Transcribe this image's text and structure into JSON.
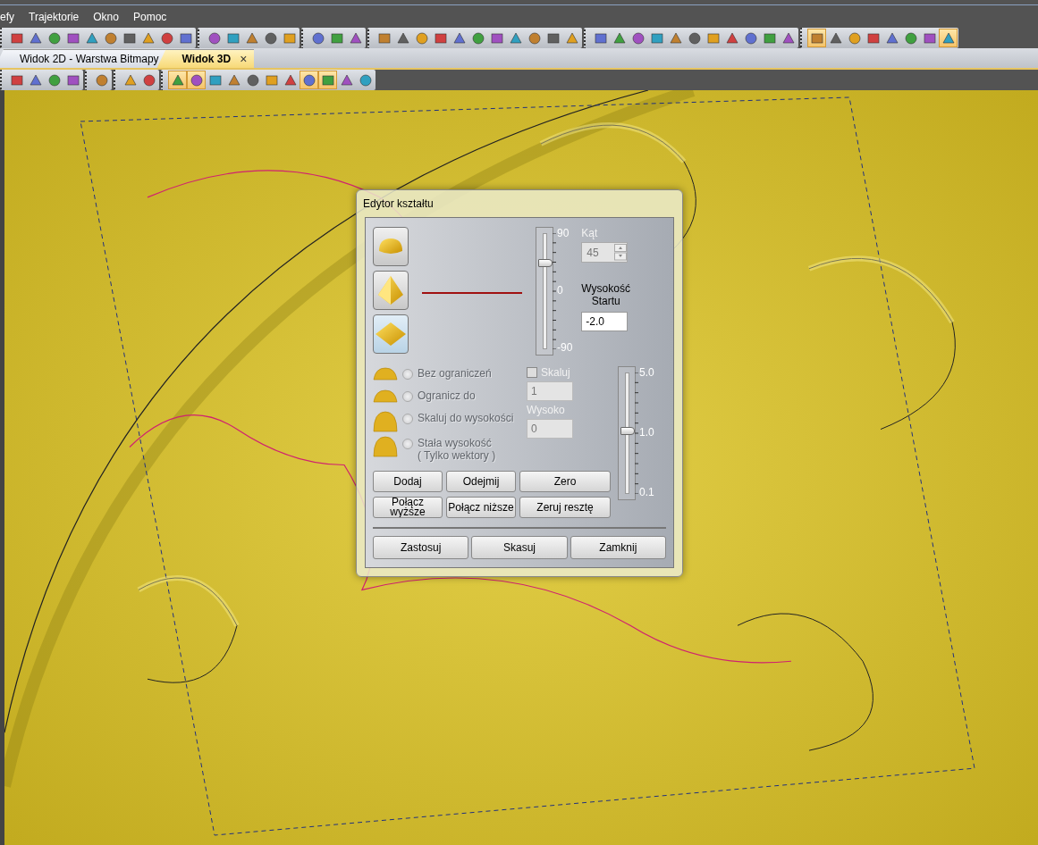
{
  "menu": [
    "efy",
    "Trajektorie",
    "Okno",
    "Pomoc"
  ],
  "toolbar": [
    [
      {
        "selected": false
      },
      {
        "selected": false
      },
      {
        "selected": false
      },
      {
        "selected": false
      },
      {
        "selected": false
      },
      {
        "selected": false
      },
      {
        "selected": false
      },
      {
        "selected": false
      },
      {
        "selected": false
      },
      {
        "selected": false
      }
    ],
    [
      {
        "selected": false
      },
      {
        "selected": false
      },
      {
        "selected": false
      },
      {
        "selected": false
      },
      {
        "selected": false
      }
    ],
    [
      {
        "selected": false
      },
      {
        "selected": false
      },
      {
        "selected": false
      }
    ],
    [
      {
        "selected": false
      },
      {
        "selected": false
      },
      {
        "selected": false
      },
      {
        "selected": false
      },
      {
        "selected": false
      },
      {
        "selected": false
      },
      {
        "selected": false
      },
      {
        "selected": false
      },
      {
        "selected": false
      },
      {
        "selected": false
      },
      {
        "selected": false
      }
    ],
    [
      {
        "selected": false
      },
      {
        "selected": false
      },
      {
        "selected": false
      },
      {
        "selected": false
      },
      {
        "selected": false
      },
      {
        "selected": false
      },
      {
        "selected": false
      },
      {
        "selected": false
      },
      {
        "selected": false
      },
      {
        "selected": false
      },
      {
        "selected": false
      }
    ],
    [
      {
        "selected": true
      },
      {
        "selected": false
      },
      {
        "selected": false
      },
      {
        "selected": false
      },
      {
        "selected": false
      },
      {
        "selected": false
      },
      {
        "selected": false
      },
      {
        "selected": true
      }
    ]
  ],
  "tabs": [
    {
      "label": "Widok 2D - Warstwa Bitmapy",
      "selected": false
    },
    {
      "label": "Widok 3D",
      "selected": true,
      "close": "×"
    }
  ],
  "view_toolbar": [
    [
      {
        "selected": false
      },
      {
        "selected": false
      },
      {
        "selected": false
      },
      {
        "selected": false
      }
    ],
    [
      {
        "selected": false
      }
    ],
    [
      {
        "selected": false
      },
      {
        "selected": false
      }
    ],
    [
      {
        "selected": true
      },
      {
        "selected": true
      },
      {
        "selected": false
      },
      {
        "selected": false
      },
      {
        "selected": false
      },
      {
        "selected": false
      },
      {
        "selected": false
      },
      {
        "selected": true
      },
      {
        "selected": true
      },
      {
        "selected": false
      },
      {
        "selected": false
      }
    ]
  ],
  "dialog": {
    "title": "Edytor kształtu",
    "shapes": [
      {
        "kind": "dome",
        "selected": false
      },
      {
        "kind": "pyramid",
        "selected": false
      },
      {
        "kind": "plane",
        "selected": true
      }
    ],
    "angle_slider": {
      "labels": [
        "90",
        "0",
        "-90"
      ],
      "level": 0.75
    },
    "angle": {
      "label": "Kąt",
      "value": "45",
      "disabled": true
    },
    "start_height": {
      "label": "Wysokość\nStartu",
      "value": "-2.0"
    },
    "modes": [
      {
        "label": "Bez ograniczeń",
        "selected": false,
        "disabled": true
      },
      {
        "label": "Ogranicz do",
        "selected": false,
        "disabled": true
      },
      {
        "label": "Skaluj do wysokości",
        "selected": false,
        "disabled": true
      },
      {
        "label": "Stała wysokość\n( Tylko wektory )",
        "selected": false,
        "disabled": true
      }
    ],
    "scale": {
      "label": "Skaluj",
      "checked": false,
      "disabled": true,
      "value": "1"
    },
    "height": {
      "label": "Wysoko",
      "value": "0",
      "disabled": true
    },
    "scale_slider": {
      "labels": [
        "5.0",
        "1.0",
        "0.1"
      ],
      "level": 0.52
    },
    "buttons": [
      [
        "Dodaj",
        "Odejmij",
        "Zero"
      ],
      [
        "Połącz\nwyższe",
        "Połącz niższe",
        "Zeruj resztę"
      ]
    ],
    "footer_buttons": [
      "Zastosuj",
      "Skasuj",
      "Zamknij"
    ]
  }
}
